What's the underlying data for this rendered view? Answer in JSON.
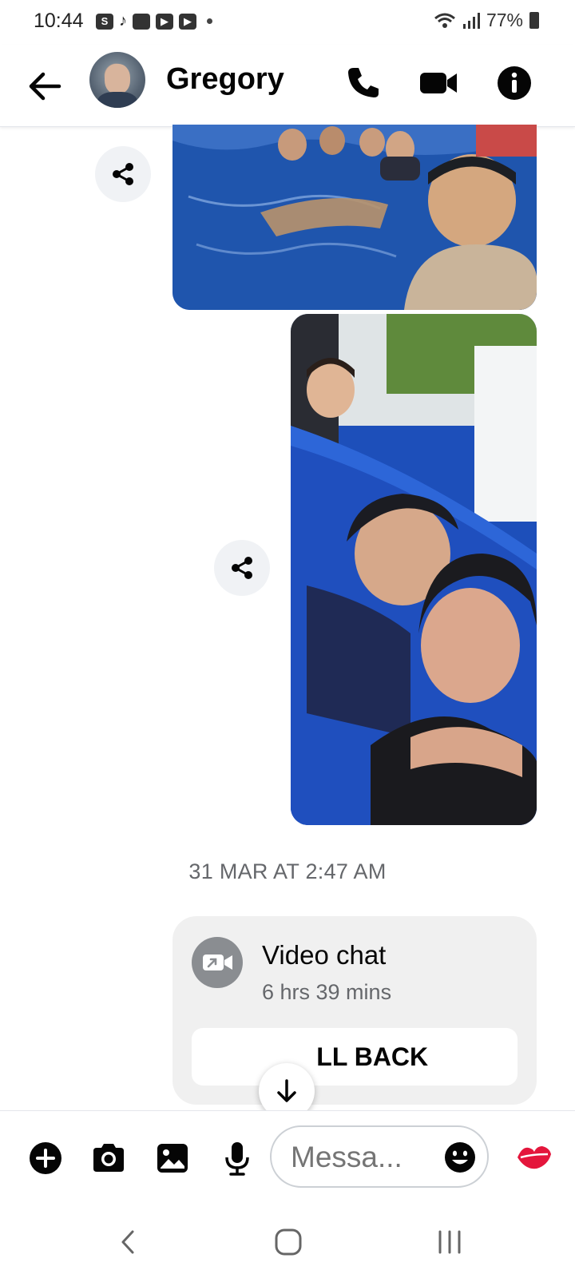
{
  "status_bar": {
    "time": "10:44",
    "battery": "77%"
  },
  "header": {
    "contact_name": "Gregory",
    "icons": [
      "back-arrow-icon",
      "phone-icon",
      "video-camera-icon",
      "info-icon"
    ]
  },
  "chat": {
    "photos": [
      {
        "description_icon": "photo-pool-group"
      },
      {
        "description_icon": "photo-pool-selfie"
      }
    ],
    "timestamp": "31 MAR AT 2:47 AM",
    "call_card": {
      "title": "Video chat",
      "duration": "6 hrs 39 mins",
      "button_label": "CALL BACK",
      "button_visible_label": "     LL BACK"
    }
  },
  "composer": {
    "placeholder": "Messa...",
    "icons": [
      "plus-icon",
      "camera-icon",
      "gallery-icon",
      "microphone-icon",
      "emoji-icon",
      "kiss-lips-icon"
    ]
  },
  "colors": {
    "accent_red": "#e4163c",
    "muted_text": "#65676b",
    "bubble_bg": "#f0f0f0"
  }
}
